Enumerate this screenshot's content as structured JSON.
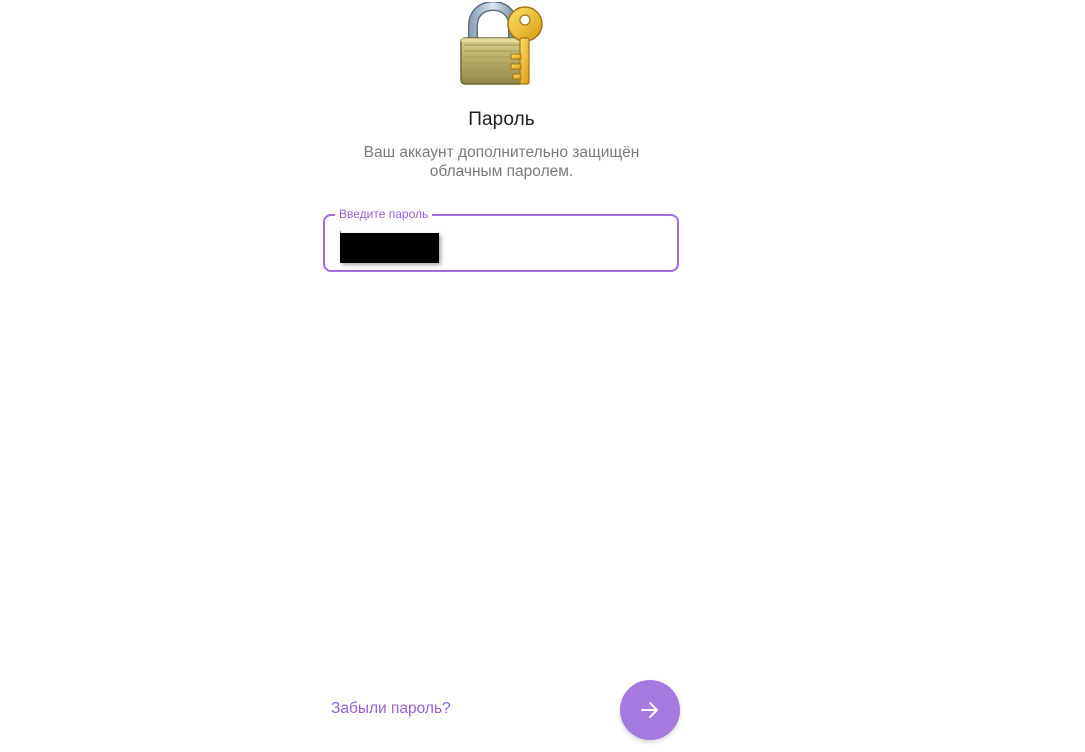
{
  "app": {
    "accent_color": "#a56be0",
    "button_color": "#a47ae0",
    "text_color": "#1f1f1f",
    "muted_color": "#7a7a7a"
  },
  "header": {
    "icon": "lock-with-key-icon",
    "title": "Пароль",
    "subtitle_line1": "Ваш аккаунт дополнительно защищён",
    "subtitle_line2": "облачным паролем."
  },
  "password_field": {
    "label": "Введите пароль",
    "value": "",
    "redacted": true
  },
  "footer": {
    "forgot_label": "Забыли пароль?",
    "next_icon": "arrow-right-icon"
  }
}
